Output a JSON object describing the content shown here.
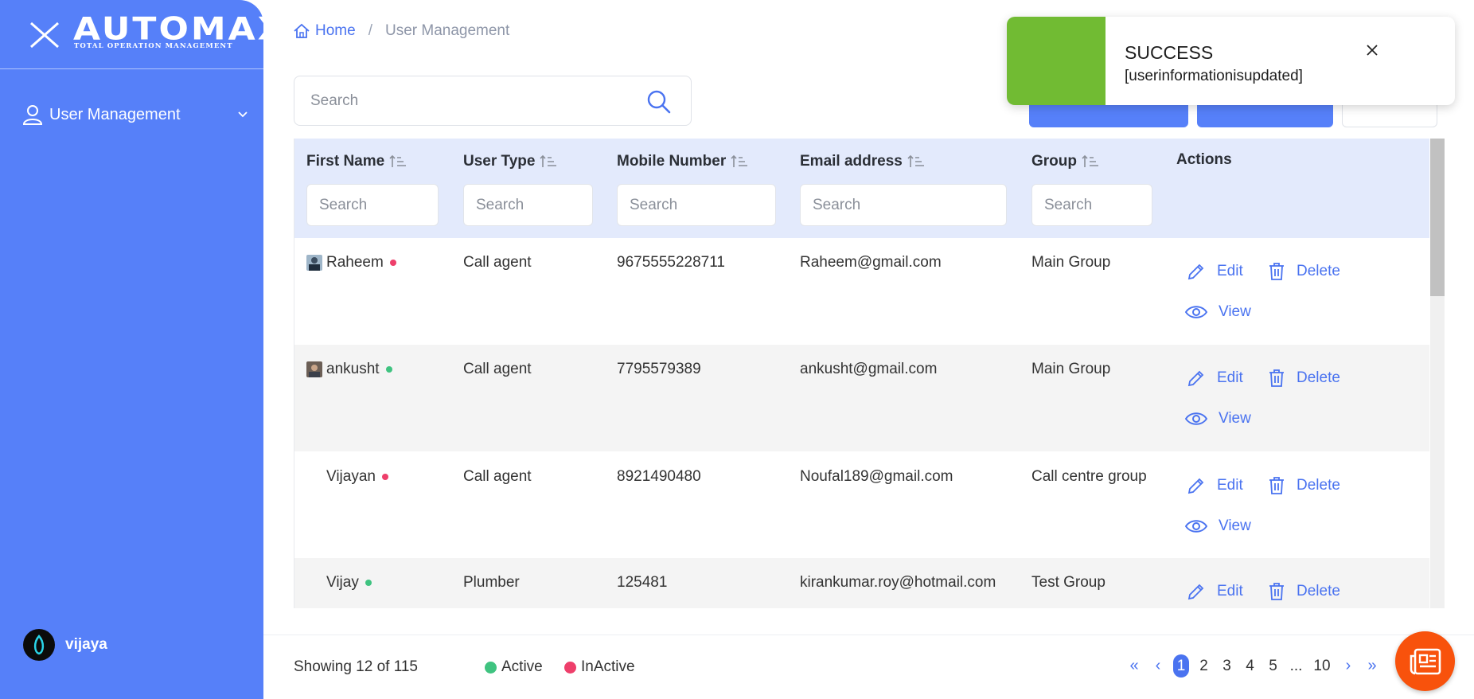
{
  "sidebar": {
    "logo_text": "AUTOMAX",
    "logo_subtitle": "TOTAL OPERATION MANAGEMENT",
    "menu_item": "User Management",
    "user_name": "vijaya"
  },
  "breadcrumb": {
    "home": "Home",
    "separator": "/",
    "current": "User Management"
  },
  "search": {
    "placeholder": "Search"
  },
  "table": {
    "columns": [
      {
        "label": "First Name",
        "filter_placeholder": "Search"
      },
      {
        "label": "User Type",
        "filter_placeholder": "Search"
      },
      {
        "label": "Mobile Number",
        "filter_placeholder": "Search"
      },
      {
        "label": "Email address",
        "filter_placeholder": "Search"
      },
      {
        "label": "Group",
        "filter_placeholder": "Search"
      },
      {
        "label": "Actions"
      }
    ],
    "rows": [
      {
        "first_name": "Raheem",
        "status": "inactive",
        "user_type": "Call agent",
        "mobile": "9675555228711",
        "email": "Raheem@gmail.com",
        "group": "Main Group"
      },
      {
        "first_name": "ankusht",
        "status": "active",
        "user_type": "Call agent",
        "mobile": "7795579389",
        "email": "ankusht@gmail.com",
        "group": "Main Group"
      },
      {
        "first_name": "Vijayan",
        "status": "inactive",
        "user_type": "Call agent",
        "mobile": "8921490480",
        "email": "Noufal189@gmail.com",
        "group": "Call centre group"
      },
      {
        "first_name": "Vijay",
        "status": "active",
        "user_type": "Plumber",
        "mobile": "125481",
        "email": "kirankumar.roy@hotmail.com",
        "group": "Test Group"
      }
    ],
    "actions": {
      "edit": "Edit",
      "delete": "Delete",
      "view": "View"
    }
  },
  "footer": {
    "showing": "Showing 12 of 115",
    "legend_active": "Active",
    "legend_inactive": "InActive",
    "pages": [
      "1",
      "2",
      "3",
      "4",
      "5",
      "...",
      "10"
    ],
    "current_page": "1"
  },
  "toast": {
    "title": "SUCCESS",
    "message": "[userinformationisupdated]"
  },
  "colors": {
    "sidebar": "#5680f9",
    "accent": "#4a73f0",
    "active": "#3fc380",
    "inactive": "#ee3f6b",
    "toast_bar": "#71bb33",
    "fab": "#f8520c"
  }
}
